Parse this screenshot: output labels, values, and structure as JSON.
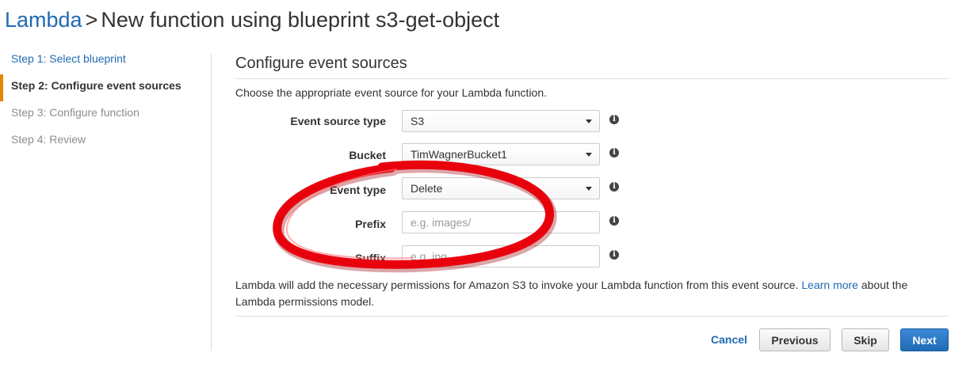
{
  "header": {
    "crumb": "Lambda",
    "separator": ">",
    "title": "New function using blueprint s3-get-object"
  },
  "steps": [
    {
      "label": "Step 1: Select blueprint",
      "state": "done"
    },
    {
      "label": "Step 2: Configure event sources",
      "state": "active"
    },
    {
      "label": "Step 3: Configure function",
      "state": "todo"
    },
    {
      "label": "Step 4: Review",
      "state": "todo"
    }
  ],
  "main": {
    "section_title": "Configure event sources",
    "description": "Choose the appropriate event source for your Lambda function.",
    "fields": {
      "event_source_type": {
        "label": "Event source type",
        "value": "S3"
      },
      "bucket": {
        "label": "Bucket",
        "value": "TimWagnerBucket1"
      },
      "event_type": {
        "label": "Event type",
        "value": "Delete"
      },
      "prefix": {
        "label": "Prefix",
        "value": "",
        "placeholder": "e.g. images/"
      },
      "suffix": {
        "label": "Suffix",
        "value": "",
        "placeholder": "e.g. jpg"
      }
    },
    "info_glyph": "i",
    "note_text": "Lambda will add the necessary permissions for Amazon S3 to invoke your Lambda function from this event source.",
    "note_link": "Learn more",
    "note_tail": "about the Lambda permissions model."
  },
  "buttons": {
    "cancel": "Cancel",
    "previous": "Previous",
    "skip": "Skip",
    "next": "Next"
  },
  "colors": {
    "link": "#1f6ab3",
    "active_step_marker": "#e88400",
    "primary_button": "#1f6ab3",
    "annotation": "#e8000d"
  },
  "icons": {
    "dropdown": "chevron-down-icon",
    "info": "info-icon"
  }
}
